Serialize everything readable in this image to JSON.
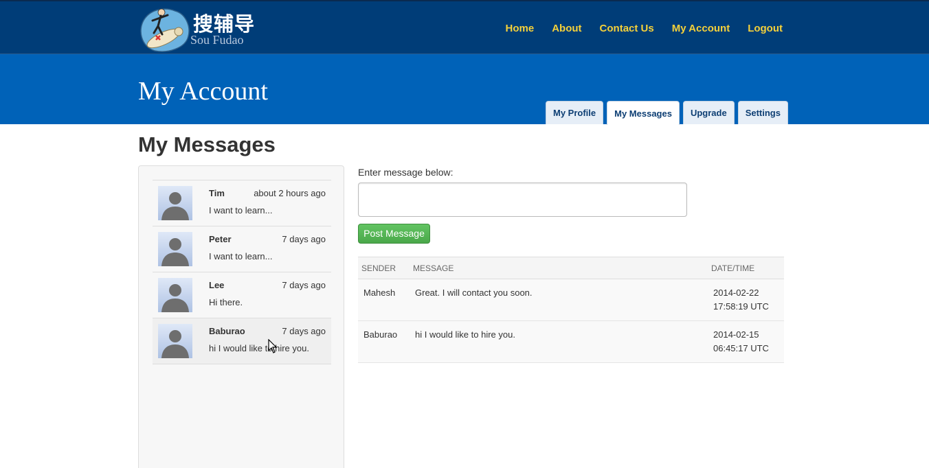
{
  "brand": {
    "name_cn": "搜辅导",
    "name_en": "Sou Fudao"
  },
  "nav": {
    "items": [
      {
        "label": "Home"
      },
      {
        "label": "About"
      },
      {
        "label": "Contact Us"
      },
      {
        "label": "My Account"
      },
      {
        "label": "Logout"
      }
    ]
  },
  "banner": {
    "title": "My Account",
    "tabs": [
      {
        "label": "My Profile",
        "active": false
      },
      {
        "label": "My Messages",
        "active": true
      },
      {
        "label": "Upgrade",
        "active": false
      },
      {
        "label": "Settings",
        "active": false
      }
    ]
  },
  "main": {
    "section_title": "My Messages",
    "conversations": [
      {
        "name": "Tim",
        "time": "about 2 hours ago",
        "preview": "I want to learn..."
      },
      {
        "name": "Peter",
        "time": "7 days ago",
        "preview": "I want to learn..."
      },
      {
        "name": "Lee",
        "time": "7 days ago",
        "preview": "Hi there."
      },
      {
        "name": "Baburao",
        "time": "7 days ago",
        "preview": "hi I would like to hire you."
      }
    ],
    "form": {
      "label": "Enter message below:",
      "value": "",
      "button_label": "Post Message"
    },
    "table": {
      "headers": [
        "SENDER",
        "MESSAGE",
        "DATE/TIME"
      ],
      "rows": [
        {
          "sender": "Mahesh",
          "message": "Great. I will contact you soon.",
          "date": "2014-02-22",
          "time": "17:58:19 UTC"
        },
        {
          "sender": "Baburao",
          "message": "hi I would like to hire you.",
          "date": "2014-02-15",
          "time": "06:45:17 UTC"
        }
      ]
    }
  },
  "colors": {
    "topbar": "#003d78",
    "banner": "#0062b8",
    "nav_link": "#f5d13a",
    "button": "#5cb85c"
  }
}
